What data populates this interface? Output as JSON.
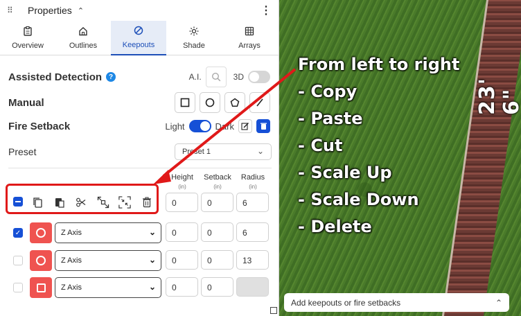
{
  "panel": {
    "title": "Properties",
    "tabs": [
      {
        "label": "Overview",
        "icon": "clipboard-icon",
        "active": false
      },
      {
        "label": "Outlines",
        "icon": "home-icon",
        "active": false
      },
      {
        "label": "Keepouts",
        "icon": "no-entry-icon",
        "active": true
      },
      {
        "label": "Shade",
        "icon": "sun-icon",
        "active": false
      },
      {
        "label": "Arrays",
        "icon": "grid-icon",
        "active": false
      }
    ],
    "assisted_detection": {
      "label": "Assisted Detection",
      "ai_label": "A.I.",
      "three_d_label": "3D",
      "three_d_enabled": false
    },
    "manual": {
      "label": "Manual",
      "tools": [
        "square-icon",
        "circle-icon",
        "pentagon-icon",
        "line-icon"
      ]
    },
    "fire_setback": {
      "label": "Fire Setback",
      "light_label": "Light",
      "dark_label": "Dark",
      "dark_enabled": true
    },
    "preset": {
      "label": "Preset",
      "value": "Preset 1"
    },
    "columns": [
      {
        "label": "Height",
        "unit": "(in)"
      },
      {
        "label": "Setback",
        "unit": "(in)"
      },
      {
        "label": "Radius",
        "unit": "(in)"
      }
    ],
    "bulk_row": {
      "height": "0",
      "setback": "0",
      "radius": "6"
    },
    "rows": [
      {
        "checked": true,
        "shape": "circle",
        "axis": "Z Axis",
        "height": "0",
        "setback": "0",
        "radius": "6",
        "radius_disabled": false
      },
      {
        "checked": false,
        "shape": "circle",
        "axis": "Z Axis",
        "height": "0",
        "setback": "0",
        "radius": "13",
        "radius_disabled": false
      },
      {
        "checked": false,
        "shape": "square",
        "axis": "Z Axis",
        "height": "0",
        "setback": "0",
        "radius": "",
        "radius_disabled": true
      }
    ]
  },
  "map": {
    "dimension_label": "23' 6\""
  },
  "bottom_bar": {
    "label": "Add keepouts or fire setbacks"
  },
  "annotation": {
    "heading": "From left to right",
    "items": [
      "- Copy",
      "- Paste",
      "- Cut",
      "- Scale Up",
      "- Scale Down",
      "- Delete"
    ]
  },
  "colors": {
    "accent": "#1650d6",
    "highlight": "#e01919",
    "shape_red": "#ef5350"
  }
}
